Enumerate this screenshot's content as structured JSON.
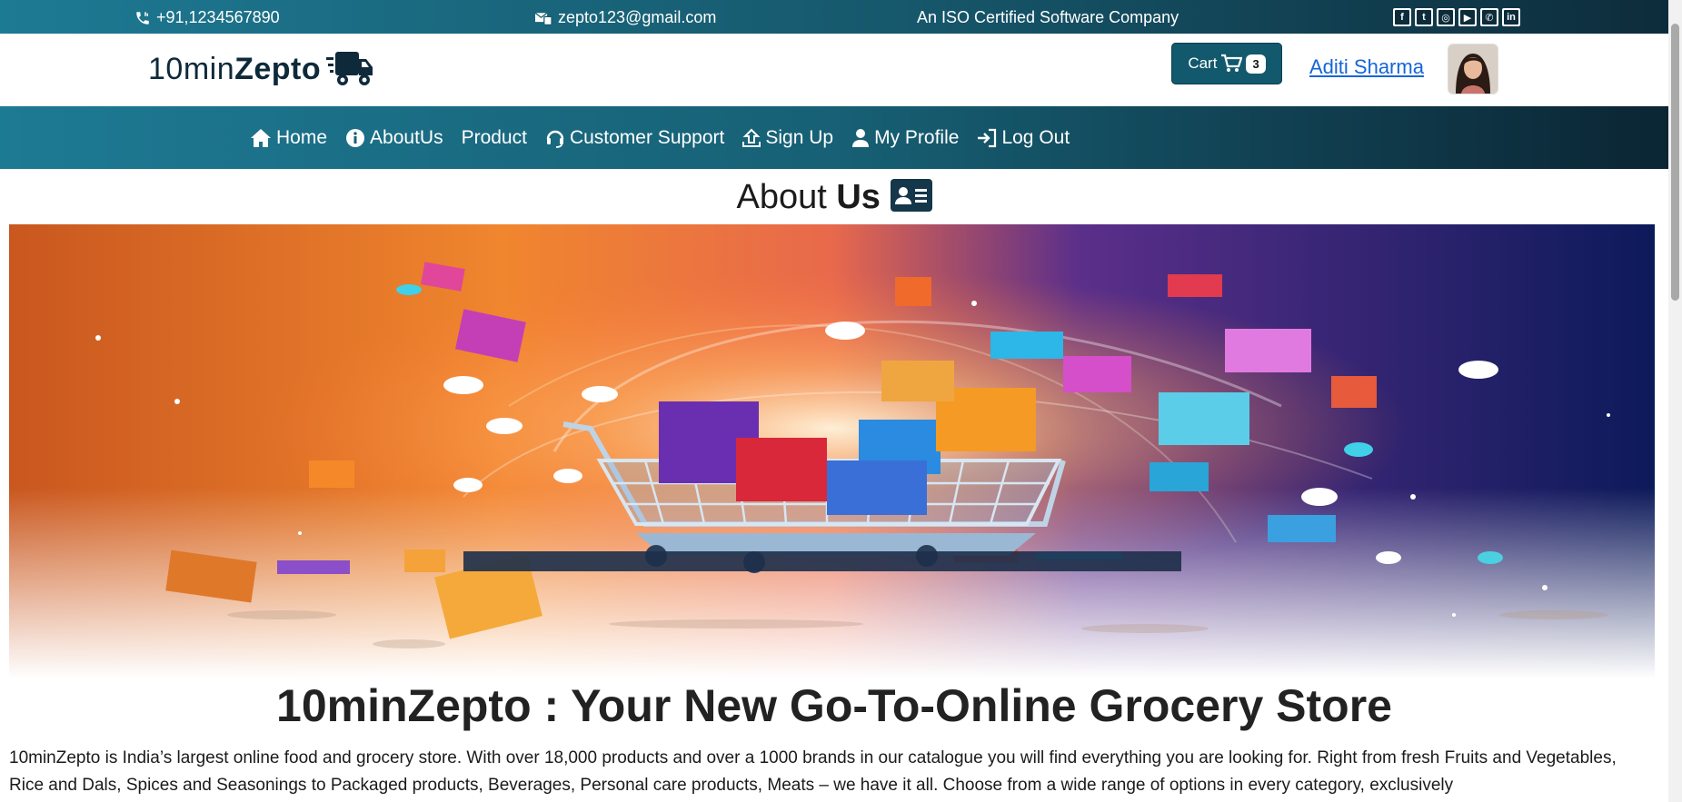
{
  "topbar": {
    "phone": "+91,1234567890",
    "email": "zepto123@gmail.com",
    "tagline": "An ISO Certified Software Company",
    "social": [
      "facebook-icon",
      "twitter-icon",
      "instagram-icon",
      "youtube-icon",
      "whatsapp-icon",
      "linkedin-icon"
    ]
  },
  "header": {
    "logo_light": "10min",
    "logo_bold": "Zepto",
    "cart_label": "Cart",
    "cart_count": "3",
    "user_name": "Aditi Sharma"
  },
  "nav": {
    "items": [
      {
        "label": "Home",
        "icon": "home-icon"
      },
      {
        "label": "AboutUs",
        "icon": "info-icon"
      },
      {
        "label": "Product",
        "icon": ""
      },
      {
        "label": "Customer Support",
        "icon": "headset-icon"
      },
      {
        "label": "Sign Up",
        "icon": "upload-icon"
      },
      {
        "label": "My Profile",
        "icon": "user-icon"
      },
      {
        "label": "Log Out",
        "icon": "logout-icon"
      }
    ]
  },
  "about": {
    "title_light": "About ",
    "title_bold": "Us"
  },
  "content": {
    "headline": "10minZepto : Your New Go-To-Online Grocery Store",
    "paragraph": "10minZepto is India’s largest online food and grocery store. With over 18,000 products and over a 1000 brands in our catalogue you will find everything you are looking for. Right from fresh Fruits and Vegetables, Rice and Dals, Spices and Seasonings to Packaged products, Beverages, Personal care products, Meats – we have it all. Choose from a wide range of options in every category, exclusively"
  },
  "colors": {
    "primary": "#12596d",
    "dark": "#0d2c3b",
    "link": "#1565d8"
  }
}
